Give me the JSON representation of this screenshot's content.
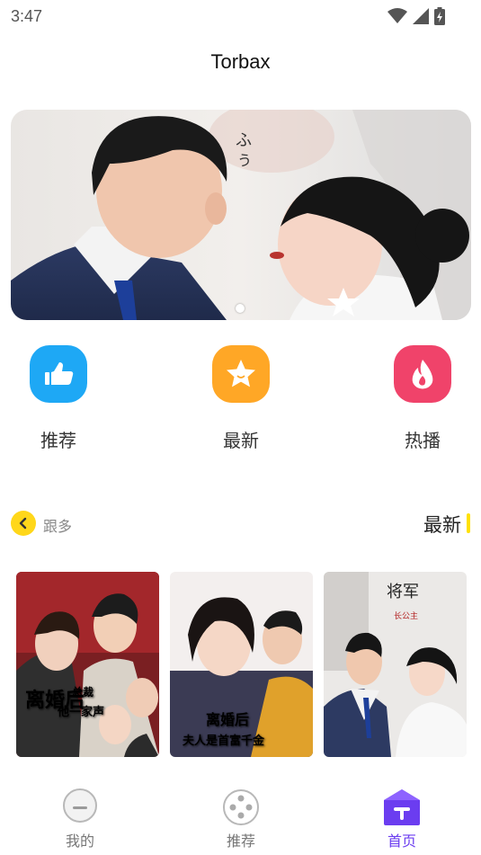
{
  "status_bar": {
    "time": "3:47",
    "icons": [
      "wifi-icon",
      "signal-icon",
      "battery-icon"
    ]
  },
  "app": {
    "title": "Torbax"
  },
  "banner": {
    "image": "drama-couple-banner",
    "active_dot": 1
  },
  "quick_actions": [
    {
      "label": "推荐",
      "icon": "thumbs-up-icon",
      "color": "#1ea8f5"
    },
    {
      "label": "最新",
      "icon": "star-icon",
      "color": "#ffa726"
    },
    {
      "label": "热播",
      "icon": "flame-icon",
      "color": "#f0436a"
    }
  ],
  "section": {
    "more_label": "跟多",
    "title": "最新",
    "accent_color": "#ffe100",
    "back_color": "#ffd71a"
  },
  "cards": [
    {
      "poster_text_1": "离婚后",
      "poster_text_2": "总裁",
      "poster_text_3": "他一家声"
    },
    {
      "poster_text_1": "离婚后",
      "poster_text_2": "夫人是首富千金"
    },
    {
      "poster_text_1": "将军",
      "poster_text_2": "长公主"
    }
  ],
  "bottom_nav": [
    {
      "label": "我的",
      "icon": "profile-icon",
      "active": false
    },
    {
      "label": "推荐",
      "icon": "discover-icon",
      "active": false
    },
    {
      "label": "首页",
      "icon": "home-icon",
      "active": true
    }
  ],
  "colors": {
    "active_nav": "#6b3df0",
    "inactive_nav": "#777777"
  }
}
